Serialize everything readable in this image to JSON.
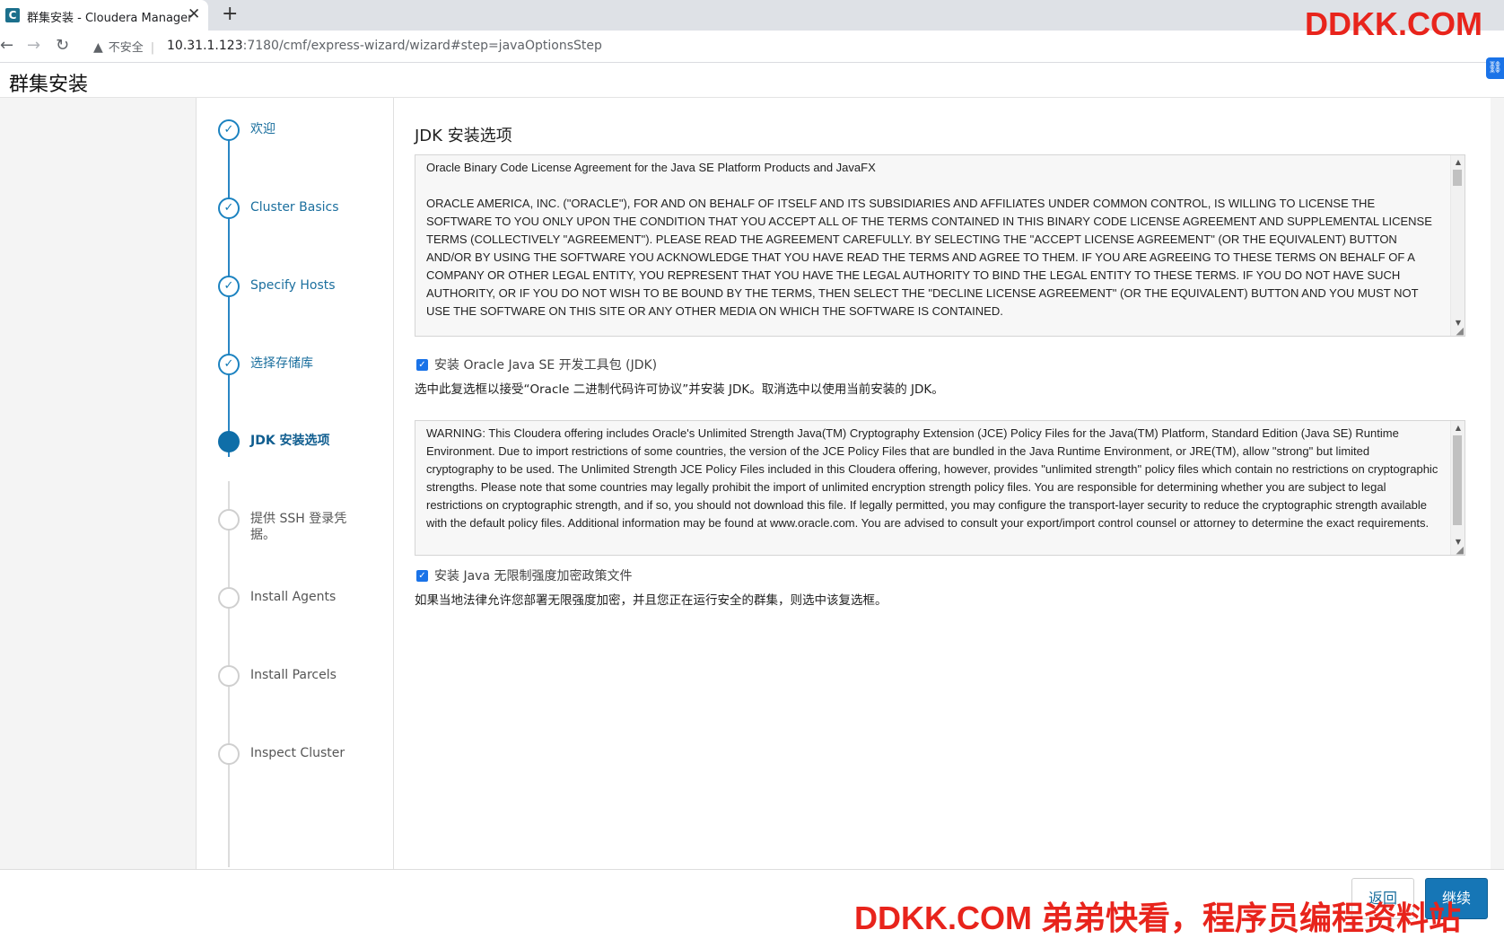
{
  "browser": {
    "tab_title": "群集安装 - Cloudera Manager",
    "tab_favicon": "C",
    "security_label": "不安全",
    "url_host": "10.31.1.123",
    "url_rest": ":7180/cmf/express-wizard/wizard#step=javaOptionsStep"
  },
  "page": {
    "title": "群集安装"
  },
  "steps": [
    {
      "label": "欢迎",
      "state": "done"
    },
    {
      "label": "Cluster Basics",
      "state": "done"
    },
    {
      "label": "Specify Hosts",
      "state": "done"
    },
    {
      "label": "选择存储库",
      "state": "done"
    },
    {
      "label": "JDK 安装选项",
      "state": "active"
    },
    {
      "label": "提供 SSH 登录凭据。",
      "state": "todo"
    },
    {
      "label": "Install Agents",
      "state": "todo"
    },
    {
      "label": "Install Parcels",
      "state": "todo"
    },
    {
      "label": "Inspect Cluster",
      "state": "todo"
    }
  ],
  "main": {
    "section_title": "JDK 安装选项",
    "license_text": "Oracle Binary Code License Agreement for the Java SE Platform Products and JavaFX\n\nORACLE AMERICA, INC. (\"ORACLE\"), FOR AND ON BEHALF OF ITSELF AND ITS SUBSIDIARIES AND AFFILIATES UNDER COMMON CONTROL, IS WILLING TO LICENSE THE SOFTWARE TO YOU ONLY UPON THE CONDITION THAT YOU ACCEPT ALL OF THE TERMS CONTAINED IN THIS BINARY CODE LICENSE AGREEMENT AND SUPPLEMENTAL LICENSE TERMS (COLLECTIVELY \"AGREEMENT\"). PLEASE READ THE AGREEMENT CAREFULLY. BY SELECTING THE \"ACCEPT LICENSE AGREEMENT\" (OR THE EQUIVALENT) BUTTON AND/OR BY USING THE SOFTWARE YOU ACKNOWLEDGE THAT YOU HAVE READ THE TERMS AND AGREE TO THEM. IF YOU ARE AGREEING TO THESE TERMS ON BEHALF OF A COMPANY OR OTHER LEGAL ENTITY, YOU REPRESENT THAT YOU HAVE THE LEGAL AUTHORITY TO BIND THE LEGAL ENTITY TO THESE TERMS. IF YOU DO NOT HAVE SUCH AUTHORITY, OR IF YOU DO NOT WISH TO BE BOUND BY THE TERMS, THEN SELECT THE \"DECLINE LICENSE AGREEMENT\" (OR THE EQUIVALENT) BUTTON AND YOU MUST NOT USE THE SOFTWARE ON THIS SITE OR ANY OTHER MEDIA ON WHICH THE SOFTWARE IS CONTAINED.",
    "jdk_checkbox_label": "安装 Oracle Java SE 开发工具包 (JDK)",
    "jdk_checked": true,
    "jdk_help": "选中此复选框以接受“Oracle 二进制代码许可协议”并安装 JDK。取消选中以使用当前安装的 JDK。",
    "jce_text": "WARNING: This Cloudera offering includes Oracle's Unlimited Strength Java(TM) Cryptography Extension (JCE) Policy Files for the Java(TM) Platform, Standard Edition (Java SE) Runtime Environment. Due to import restrictions of some countries, the version of the JCE Policy Files that are bundled in the Java Runtime Environment, or JRE(TM), allow \"strong\" but limited cryptography to be used. The Unlimited Strength JCE Policy Files included in this Cloudera offering, however, provides \"unlimited strength\" policy files which contain no restrictions on cryptographic strengths. Please note that some countries may legally prohibit the import of unlimited encryption strength policy files. You are responsible for determining whether you are subject to legal restrictions on cryptographic strength, and if so, you should not download this file. If legally permitted, you may configure the transport-layer security to reduce the cryptographic strength available with the default policy files. Additional information may be found at www.oracle.com. You are advised to consult your export/import control counsel or attorney to determine the exact requirements.",
    "jce_checkbox_label": "安装 Java 无限制强度加密政策文件",
    "jce_checked": true,
    "jce_help": "如果当地法律允许您部署无限强度加密，并且您正在运行安全的群集，则选中该复选框。"
  },
  "footer": {
    "back_label": "返回",
    "next_label": "继续"
  },
  "watermark": {
    "top": "DDKK.COM",
    "bottom": "DDKK.COM 弟弟快看，程序员编程资料站"
  }
}
